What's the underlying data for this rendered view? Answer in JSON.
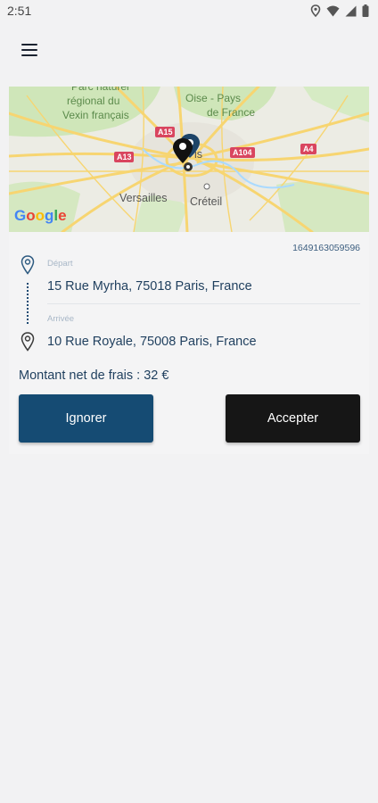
{
  "status_bar": {
    "time": "2:51",
    "icons": [
      "location-icon",
      "wifi-icon",
      "signal-icon",
      "battery-icon"
    ]
  },
  "header": {
    "menu_icon": "hamburger-menu-icon"
  },
  "map": {
    "logo": "Google",
    "labels": {
      "park": "Parc naturel régional du Vexin français",
      "region": "Oise - Pays de France",
      "city_center": "Paris",
      "versailles": "Versailles",
      "creteil": "Créteil"
    },
    "road_badges": {
      "a15": "A15",
      "a13": "A13",
      "a104": "A104",
      "a4": "A4"
    }
  },
  "ride": {
    "order_id": "1649163059596",
    "departure_label": "Départ",
    "departure_address": "15 Rue Myrha, 75018 Paris, France",
    "arrival_label": "Arrivée",
    "arrival_address": "10 Rue Royale, 75008 Paris, France",
    "amount_text": "Montant net de frais : 32  €"
  },
  "actions": {
    "ignore_label": "Ignorer",
    "accept_label": "Accepter"
  },
  "colors": {
    "primary_blue": "#154b73",
    "accept_black": "#161616",
    "text_navy": "#1f3f5e",
    "background": "#f2f2f3"
  }
}
